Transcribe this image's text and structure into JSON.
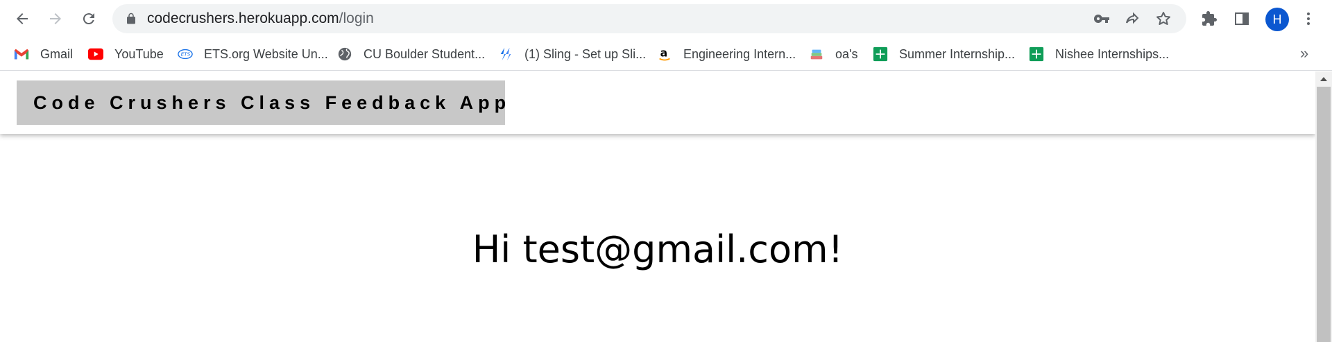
{
  "browser": {
    "url_host": "codecrushers.herokuapp.com",
    "url_path": "/login",
    "avatar_initial": "H"
  },
  "bookmarks": [
    {
      "label": "Gmail",
      "icon": "gmail-icon"
    },
    {
      "label": "YouTube",
      "icon": "youtube-icon"
    },
    {
      "label": "ETS.org Website Un...",
      "icon": "ets-icon"
    },
    {
      "label": "CU Boulder Student...",
      "icon": "globe-icon"
    },
    {
      "label": "(1) Sling - Set up Sli...",
      "icon": "sling-icon"
    },
    {
      "label": "Engineering Intern...",
      "icon": "amazon-icon"
    },
    {
      "label": "oa's",
      "icon": "books-icon"
    },
    {
      "label": "Summer Internship...",
      "icon": "sheets-icon"
    },
    {
      "label": "Nishee Internships...",
      "icon": "sheets-icon"
    }
  ],
  "page": {
    "app_title": "Code Crushers Class Feedback App",
    "greeting": "Hi test@gmail.com!"
  },
  "colors": {
    "title_box": "#c8c8c8",
    "avatar": "#0b57d0",
    "omnibox": "#f1f3f4"
  }
}
